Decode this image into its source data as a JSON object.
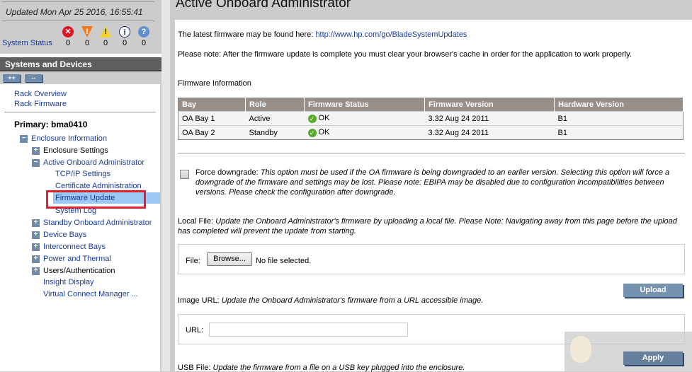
{
  "status": {
    "updated": "Updated Mon Apr 25 2016, 16:55:41",
    "label": "System Status",
    "counts": [
      "0",
      "0",
      "0",
      "0",
      "0"
    ]
  },
  "sidebar": {
    "header": "Systems and Devices",
    "expand": "++",
    "collapse": "--",
    "rack_links": [
      "Rack Overview",
      "Rack Firmware"
    ],
    "primary": "Primary: bma0410",
    "items": [
      "Enclosure Information",
      "Enclosure Settings",
      "Active Onboard Administrator",
      "TCP/IP Settings",
      "Certificate Administration",
      "Firmware Update",
      "System Log",
      "Standby Onboard Administrator",
      "Device Bays",
      "Interconnect Bays",
      "Power and Thermal",
      "Users/Authentication",
      "Insight Display",
      "Virtual Connect Manager ..."
    ]
  },
  "main": {
    "title": "Active Onboard Administrator",
    "latest_prefix": "The latest firmware may be found here: ",
    "latest_link": "http://www.hp.com/go/BladeSystemUpdates",
    "note": "Please note: After the firmware update is complete you must clear your browser's cache in order for the application to work properly.",
    "fw_info": "Firmware Information",
    "table": {
      "headers": [
        "Bay",
        "Role",
        "Firmware Status",
        "Firmware Version",
        "Hardware Version"
      ],
      "rows": [
        [
          "OA Bay 1",
          "Active",
          "OK",
          "3.32 Aug 24 2011",
          "B1"
        ],
        [
          "OA Bay 2",
          "Standby",
          "OK",
          "3.32 Aug 24 2011",
          "B1"
        ]
      ]
    },
    "force_label": "Force downgrade: ",
    "force_desc1": "This option must be used if the OA firmware is being downgraded to an earlier version. Selecting this option will force a",
    "force_desc2": "downgrade of the firmware and settings may be lost. Please note: EBIPA may be disabled due to configuration incompatibilities between",
    "force_desc3": "versions. Please check the configuration after downgrade.",
    "local_label": "Local File: ",
    "local_desc1": "Update the Onboard Administrator's firmware by uploading a local file.  Please Note: Navigating away from this page before the upload",
    "local_desc2": "has completed will prevent the update from starting.",
    "file_label": "File:",
    "browse": "Browse...",
    "no_file": "No file selected.",
    "upload": "Upload",
    "url_label_title": "Image URL: ",
    "url_desc": "Update the Onboard Administrator's firmware from a URL accessible image.",
    "url_label": "URL:",
    "url_value": "",
    "apply": "Apply",
    "usb_label": "USB File: ",
    "usb_desc": "Update the firmware from a file on a USB key plugged into the enclosure."
  }
}
